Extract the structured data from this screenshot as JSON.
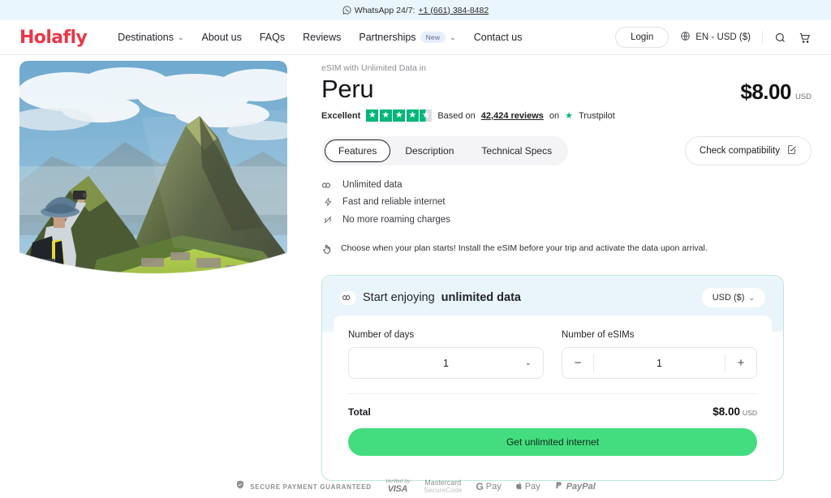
{
  "topbar": {
    "icon": "whatsapp-icon",
    "label": "WhatsApp 24/7:",
    "phone": "+1 (661) 384-8482"
  },
  "nav": {
    "logo": "Holafly",
    "links": [
      {
        "label": "Destinations",
        "caret": "⌄"
      },
      {
        "label": "About us"
      },
      {
        "label": "FAQs"
      },
      {
        "label": "Reviews"
      },
      {
        "label": "Partnerships",
        "badge": "New",
        "caret": "⌄"
      },
      {
        "label": "Contact us"
      }
    ],
    "login": "Login",
    "language": "EN - USD ($)",
    "search_icon": "search-icon",
    "cart_icon": "cart-icon",
    "globe_icon": "globe-icon"
  },
  "product": {
    "eyebrow": "eSIM with Unlimited Data in",
    "title": "Peru",
    "price": "$8.00",
    "price_currency": "USD",
    "rating": {
      "word": "Excellent",
      "stars_full": 4,
      "stars_half": 1,
      "based_on": "Based on",
      "reviews": "42,424 reviews",
      "on": "on",
      "provider": "Trustpilot",
      "star_color": "#00b67a"
    },
    "tabs": [
      {
        "label": "Features",
        "active": true
      },
      {
        "label": "Description",
        "active": false
      },
      {
        "label": "Technical Specs",
        "active": false
      }
    ],
    "compatibility_button": "Check compatibility",
    "features": [
      {
        "icon": "infinity-icon",
        "glyph": "∞",
        "label": "Unlimited data"
      },
      {
        "icon": "lightning-icon",
        "glyph": "⚡",
        "label": "Fast and reliable internet"
      },
      {
        "icon": "no-roaming-icon",
        "glyph": "📡",
        "label": "No more roaming charges"
      }
    ],
    "note": "Choose when your plan starts! Install the eSIM before your trip and activate the data upon arrival.",
    "note_icon": "hand-tap-icon"
  },
  "purchase": {
    "heading_prefix": "Start enjoying ",
    "heading_bold": "unlimited data",
    "heading_icon": "infinity-icon",
    "currency_select": "USD ($)",
    "days_label": "Number of days",
    "days_value": "1",
    "esims_label": "Number of eSIMs",
    "esims_value": "1",
    "minus": "−",
    "plus": "+",
    "total_label": "Total",
    "total_value": "$8.00",
    "total_currency": "USD",
    "cta": "Get unlimited internet",
    "cta_color": "#43dd7f",
    "border_color": "#bfe7dc",
    "header_bg": "#e9f5fb"
  },
  "payments": {
    "secure_text": "SECURE PAYMENT GUARANTEED",
    "shield_icon": "shield-icon",
    "visa_top": "Verified by",
    "visa_bottom": "VISA",
    "mc_top": "Mastercard",
    "mc_bottom": "SecureCode",
    "gpay": "Pay",
    "gpay_g": "G",
    "apay": "Pay",
    "paypal": "PayPal"
  }
}
